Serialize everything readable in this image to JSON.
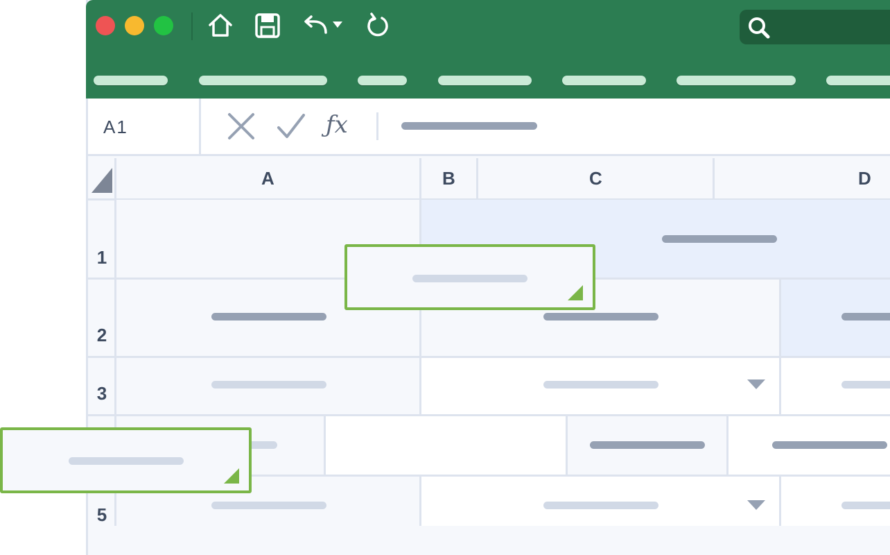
{
  "formula_bar": {
    "name_box": "A1",
    "fx_label": "ƒx"
  },
  "columns": [
    "A",
    "B",
    "C",
    "D"
  ],
  "rows": [
    "1",
    "2",
    "3",
    "5"
  ],
  "colors": {
    "titlebar": "#2c7d52",
    "accent": "#7ab648",
    "close": "#ee5454",
    "minimize": "#f8b92f",
    "maximize": "#22c243"
  }
}
